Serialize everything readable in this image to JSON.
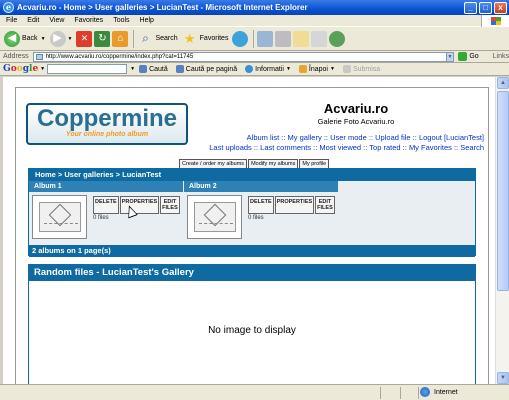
{
  "window": {
    "title": "Acvariu.ro - Home > User galleries > LucianTest - Microsoft Internet Explorer",
    "minimize": "_",
    "maximize": "□",
    "close": "x"
  },
  "menubar": [
    "File",
    "Edit",
    "View",
    "Favorites",
    "Tools",
    "Help"
  ],
  "toolbar": {
    "back": "Back",
    "search": "Search",
    "favorites": "Favorites"
  },
  "address": {
    "label": "Address",
    "url": "http://www.acvariu.ro/coppermine/index.php?cat=11745",
    "go": "Go",
    "links": "Links"
  },
  "google": {
    "logo": [
      "G",
      "o",
      "o",
      "g",
      "l",
      "e"
    ],
    "search_btn": "Caută",
    "site_search_btn": "Caută pe pagină",
    "info_btn": "Informatii",
    "back_btn": "Înapoi",
    "submit_btn": "Submisa"
  },
  "page": {
    "logo_main": "Coppermine",
    "logo_sub": "Your online photo album",
    "site_title": "Acvariu.ro",
    "site_desc": "Galerie Foto Acvariu.ro",
    "nav_line1": [
      "Album list",
      "My gallery",
      "User mode",
      "Upload file",
      "Logout [LucianTest]"
    ],
    "nav_line2": [
      "Last uploads",
      "Last comments",
      "Most viewed",
      "Top rated",
      "My Favorites",
      "Search"
    ],
    "nav_separator": "::",
    "action_buttons": [
      "Create / order my albums",
      "Modify my albums",
      "My profile"
    ],
    "breadcrumb": "Home > User galleries > LucianTest",
    "albums": [
      {
        "title": "Album 1",
        "files": "0 files"
      },
      {
        "title": "Album 2",
        "files": "0 files"
      }
    ],
    "album_buttons": {
      "delete": "DELETE",
      "properties": "PROPERTIES",
      "edit1": "EDIT",
      "edit2": "FILES"
    },
    "album_footer": "2 albums on 1 page(s)",
    "random_title": "Random files - LucianTest's Gallery",
    "no_image": "No image to display"
  },
  "statusbar": {
    "zone": "Internet"
  }
}
